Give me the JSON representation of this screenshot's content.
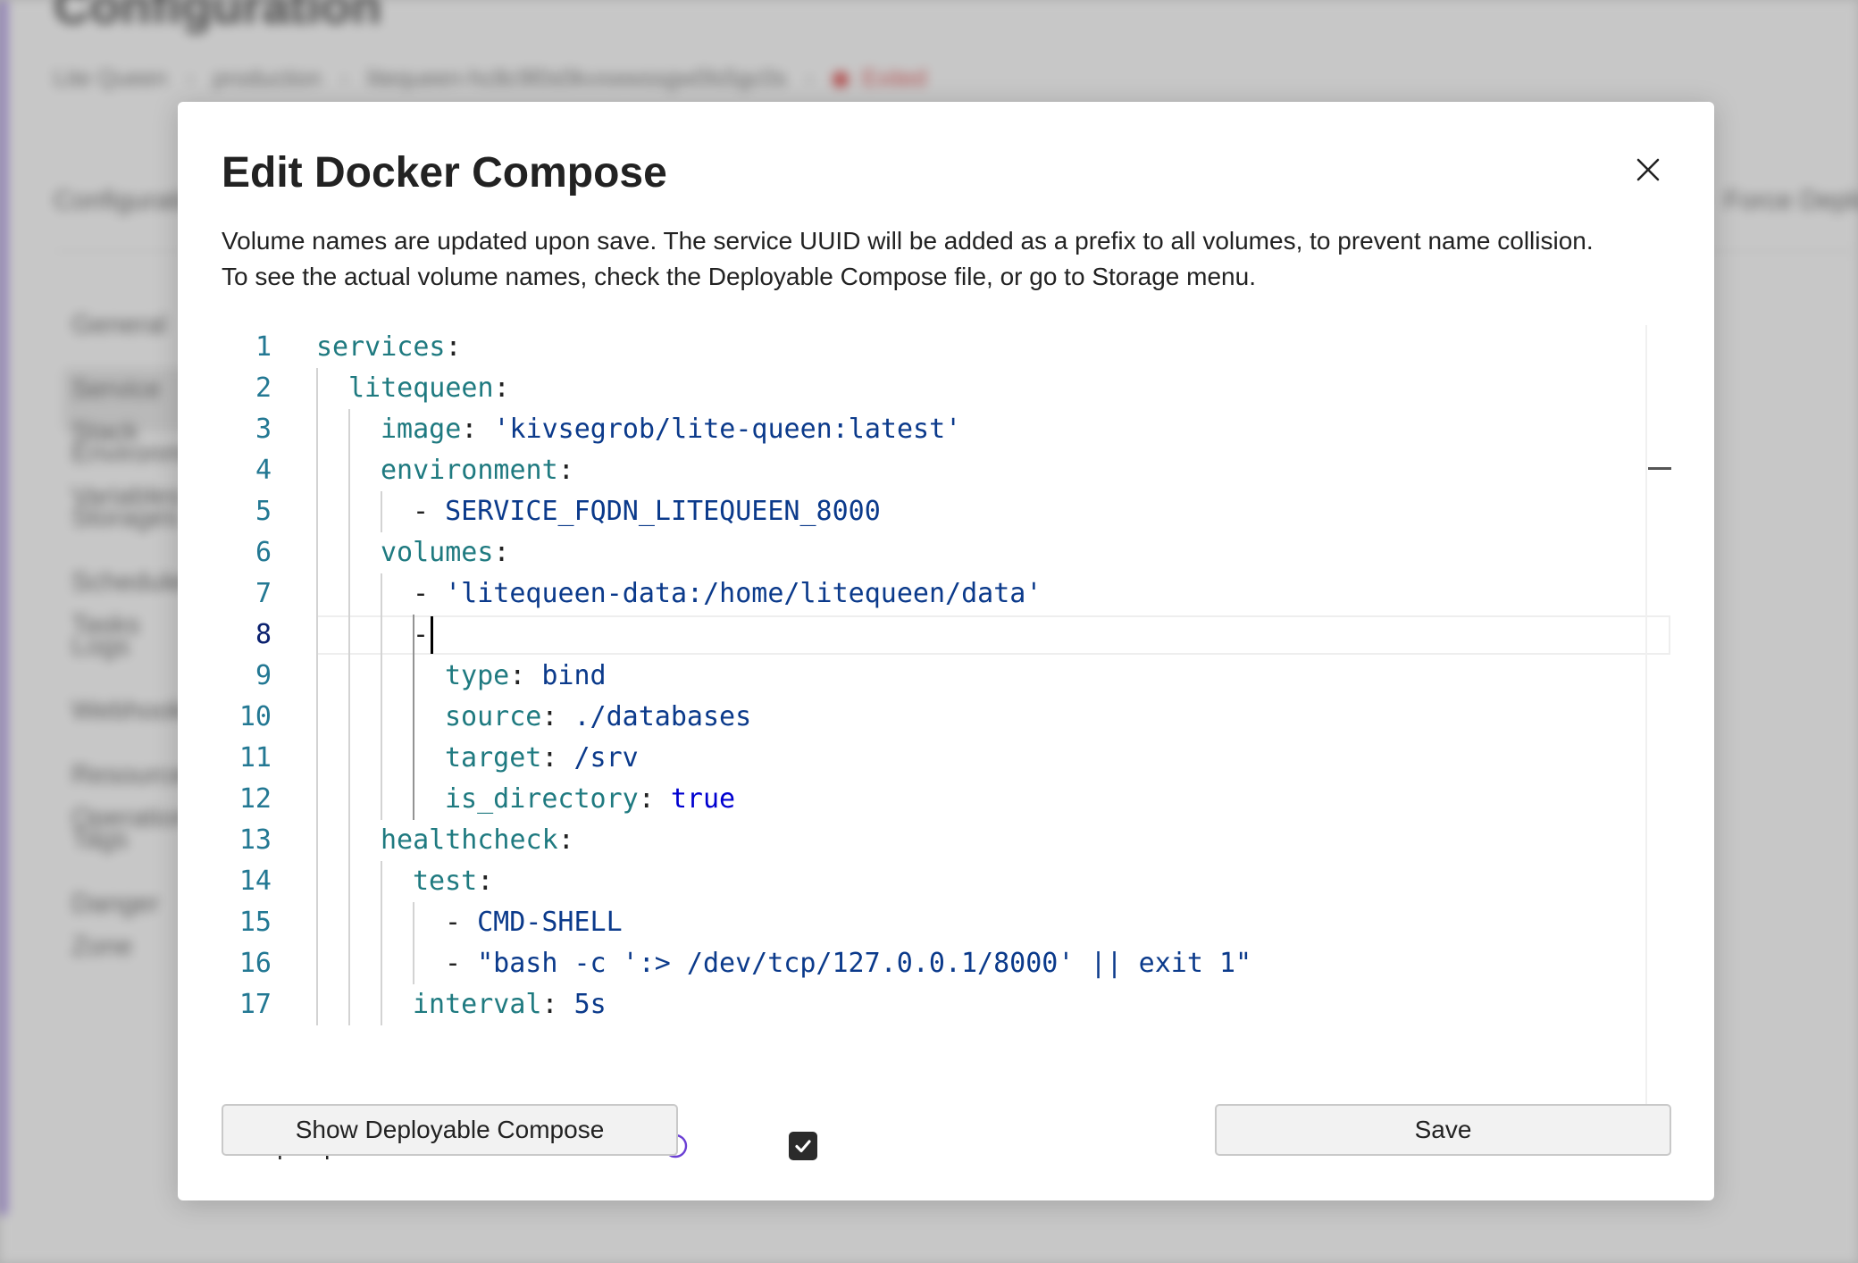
{
  "background": {
    "page_title": "Configuration",
    "breadcrumb": [
      "Lite Queen",
      "production",
      "litequeen-hc8c9l0s0kvxwwssgw0ls5gc0s"
    ],
    "status": "Exited",
    "section_label": "Configuration",
    "section_right": "Force Deploy",
    "menu_items": [
      "General",
      "Service Stack",
      "Environment Variables",
      "Storages",
      "Scheduled Tasks",
      "Logs",
      "Webhooks",
      "Resource Operations",
      "Tags",
      "Danger Zone"
    ]
  },
  "modal": {
    "title": "Edit Docker Compose",
    "close_icon": "close-icon",
    "description_line1": "Volume names are updated upon save. The service UUID will be added as a prefix to all volumes, to prevent name collision.",
    "description_line2": "To see the actual volume names, check the Deployable Compose file, or go to Storage menu."
  },
  "editor": {
    "current_line": 8,
    "lines": [
      {
        "n": "1",
        "indent": 0,
        "key": "services",
        "value": "",
        "dash": false,
        "kind": "none"
      },
      {
        "n": "2",
        "indent": 1,
        "key": "litequeen",
        "value": "",
        "dash": false,
        "kind": "none"
      },
      {
        "n": "3",
        "indent": 2,
        "key": "image",
        "value": "'kivsegrob/lite-queen:latest'",
        "dash": false,
        "kind": "str"
      },
      {
        "n": "4",
        "indent": 2,
        "key": "environment",
        "value": "",
        "dash": false,
        "kind": "none"
      },
      {
        "n": "5",
        "indent": 3,
        "key": "",
        "value": "SERVICE_FQDN_LITEQUEEN_8000",
        "dash": true,
        "kind": "val"
      },
      {
        "n": "6",
        "indent": 2,
        "key": "volumes",
        "value": "",
        "dash": false,
        "kind": "none"
      },
      {
        "n": "7",
        "indent": 3,
        "key": "",
        "value": "'litequeen-data:/home/litequeen/data'",
        "dash": true,
        "kind": "str"
      },
      {
        "n": "8",
        "indent": 3,
        "key": "",
        "value": "",
        "dash": true,
        "kind": "none"
      },
      {
        "n": "9",
        "indent": 4,
        "key": "type",
        "value": "bind",
        "dash": false,
        "kind": "val"
      },
      {
        "n": "10",
        "indent": 4,
        "key": "source",
        "value": "./databases",
        "dash": false,
        "kind": "val"
      },
      {
        "n": "11",
        "indent": 4,
        "key": "target",
        "value": "/srv",
        "dash": false,
        "kind": "val"
      },
      {
        "n": "12",
        "indent": 4,
        "key": "is_directory",
        "value": "true",
        "dash": false,
        "kind": "bool"
      },
      {
        "n": "13",
        "indent": 2,
        "key": "healthcheck",
        "value": "",
        "dash": false,
        "kind": "none"
      },
      {
        "n": "14",
        "indent": 3,
        "key": "test",
        "value": "",
        "dash": false,
        "kind": "none"
      },
      {
        "n": "15",
        "indent": 4,
        "key": "",
        "value": "CMD-SHELL",
        "dash": true,
        "kind": "val"
      },
      {
        "n": "16",
        "indent": 4,
        "key": "",
        "value": "\"bash -c ':> /dev/tcp/127.0.0.1/8000' || exit 1\"",
        "dash": true,
        "kind": "str"
      },
      {
        "n": "17",
        "indent": 3,
        "key": "interval",
        "value": "5s",
        "dash": false,
        "kind": "val"
      }
    ]
  },
  "escape": {
    "label": "Escape special characters in labels?",
    "info_icon": "info-icon",
    "checked": true
  },
  "buttons": {
    "show_label": "Show Deployable Compose",
    "save_label": "Save"
  },
  "colors": {
    "accent": "#7d5ad6",
    "info_icon": "#6b3fd4",
    "checkbox": "#2b2b2b",
    "yaml_key": "#1f7a80",
    "yaml_string": "#0b3a8b",
    "yaml_bool": "#0000d0",
    "line_number": "#237893"
  }
}
